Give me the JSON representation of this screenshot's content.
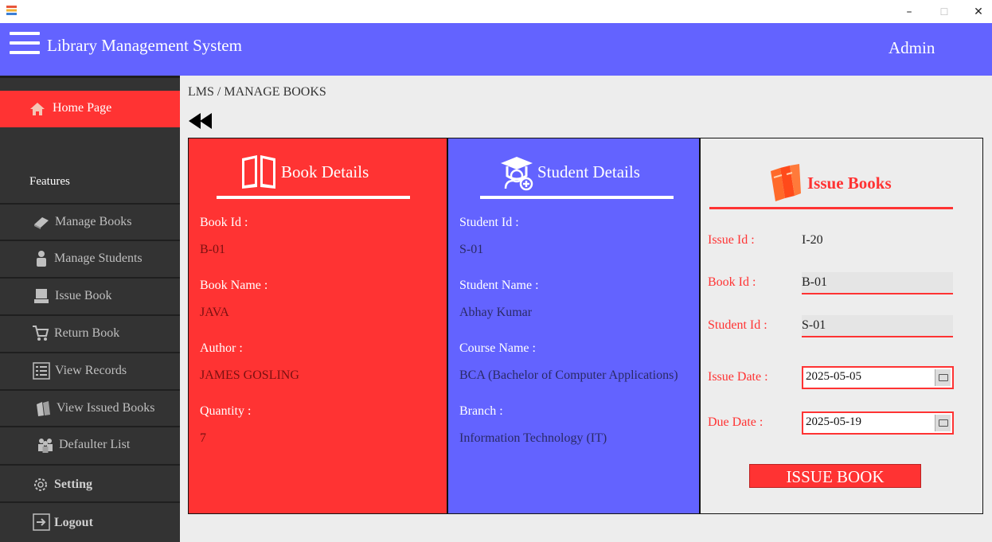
{
  "window": {
    "minimize": "–",
    "maximize": "☐",
    "close": "✕"
  },
  "header": {
    "title": "Library Management System",
    "user": "Admin"
  },
  "sidebar": {
    "home": "Home Page",
    "features_heading": "Features",
    "items": [
      {
        "label": "Manage Books",
        "icon": "book-icon"
      },
      {
        "label": "Manage Students",
        "icon": "student-icon"
      },
      {
        "label": "Issue Book",
        "icon": "issue-icon"
      },
      {
        "label": "Return Book",
        "icon": "cart-icon"
      },
      {
        "label": "View Records",
        "icon": "list-icon"
      },
      {
        "label": "View Issued Books",
        "icon": "books-icon"
      },
      {
        "label": "Defaulter List",
        "icon": "group-icon"
      },
      {
        "label": "Setting",
        "icon": "gear-icon"
      },
      {
        "label": "Logout",
        "icon": "logout-icon"
      }
    ]
  },
  "breadcrumb": "LMS / MANAGE BOOKS",
  "book_details": {
    "title": "Book Details",
    "fields": [
      {
        "label": "Book Id :",
        "value": "B-01"
      },
      {
        "label": "Book Name :",
        "value": "JAVA"
      },
      {
        "label": "Author :",
        "value": "JAMES GOSLING"
      },
      {
        "label": "Quantity :",
        "value": "7"
      }
    ]
  },
  "student_details": {
    "title": "Student Details",
    "fields": [
      {
        "label": "Student Id :",
        "value": "S-01"
      },
      {
        "label": "Student Name :",
        "value": "Abhay Kumar"
      },
      {
        "label": "Course Name :",
        "value": "BCA (Bachelor of Computer Applications)"
      },
      {
        "label": "Branch :",
        "value": "Information Technology (IT)"
      }
    ]
  },
  "issue_books": {
    "title": "Issue Books",
    "issue_id_label": "Issue Id :",
    "issue_id_value": "I-20",
    "book_id_label": "Book Id :",
    "book_id_value": "B-01",
    "student_id_label": "Student Id :",
    "student_id_value": "S-01",
    "issue_date_label": "Issue Date :",
    "issue_date_value": "2025-05-05",
    "due_date_label": "Due Date :",
    "due_date_value": "2025-05-19",
    "button": "ISSUE BOOK"
  },
  "colors": {
    "accent_blue": "#6363ff",
    "accent_red": "#ff3333",
    "sidebar": "#333333"
  }
}
